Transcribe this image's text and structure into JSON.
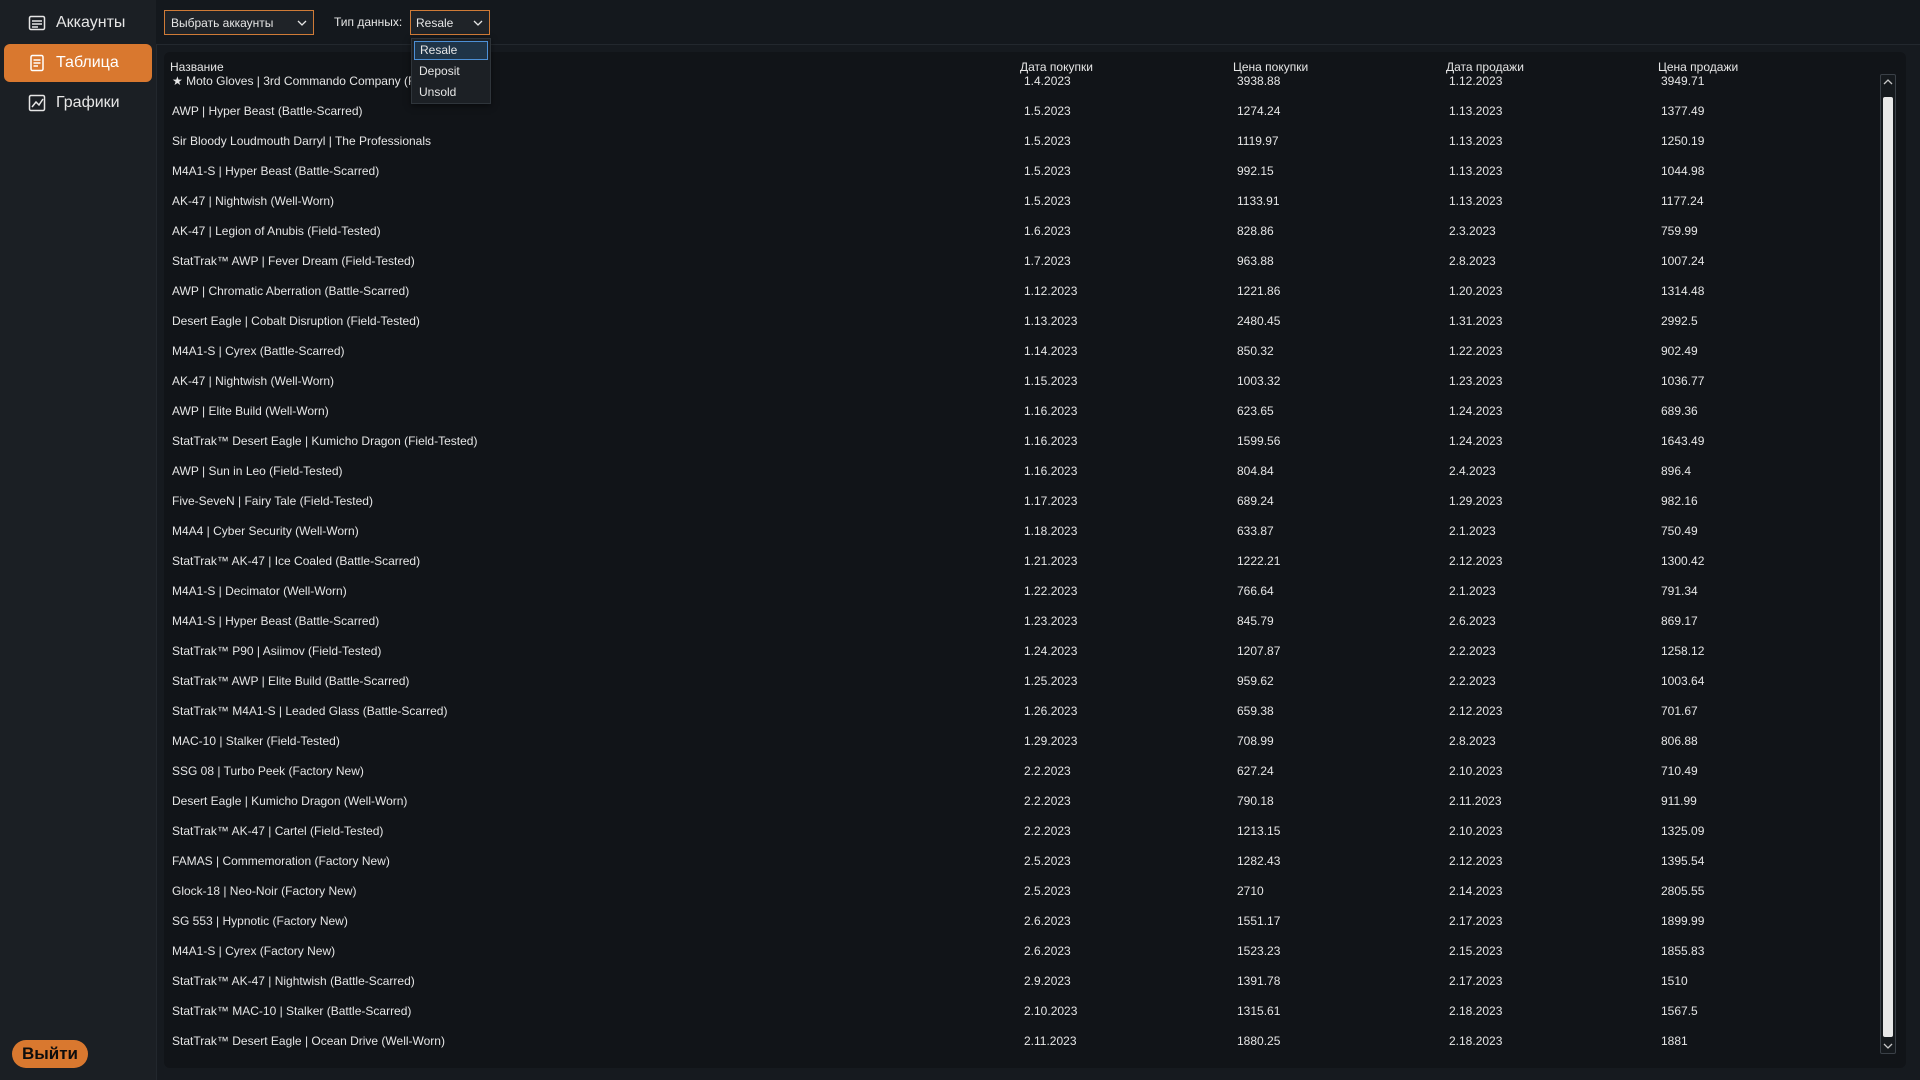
{
  "sidebar": {
    "items": [
      {
        "label": "Аккаунты",
        "icon": "accounts-icon"
      },
      {
        "label": "Таблица",
        "icon": "table-icon",
        "active": true
      },
      {
        "label": "Графики",
        "icon": "chart-icon"
      }
    ],
    "logout_label": "Выйти"
  },
  "toolbar": {
    "account_select": "Выбрать аккаунты",
    "type_label": "Тип данных:",
    "type_value": "Resale",
    "type_options": [
      "Resale",
      "Deposit",
      "Unsold"
    ]
  },
  "table": {
    "headers": [
      "Название",
      "Дата покупки",
      "Цена покупки",
      "Дата продажи",
      "Цена продажи"
    ],
    "rows": [
      [
        "★ Moto Gloves | 3rd Commando Company (F",
        "1.4.2023",
        "3938.88",
        "1.12.2023",
        "3949.71"
      ],
      [
        "AWP | Hyper Beast (Battle-Scarred)",
        "1.5.2023",
        "1274.24",
        "1.13.2023",
        "1377.49"
      ],
      [
        "Sir Bloody Loudmouth Darryl | The Professionals",
        "1.5.2023",
        "1119.97",
        "1.13.2023",
        "1250.19"
      ],
      [
        "M4A1-S | Hyper Beast (Battle-Scarred)",
        "1.5.2023",
        "992.15",
        "1.13.2023",
        "1044.98"
      ],
      [
        "AK-47 | Nightwish (Well-Worn)",
        "1.5.2023",
        "1133.91",
        "1.13.2023",
        "1177.24"
      ],
      [
        "AK-47 | Legion of Anubis (Field-Tested)",
        "1.6.2023",
        "828.86",
        "2.3.2023",
        "759.99"
      ],
      [
        "StatTrak™ AWP | Fever Dream (Field-Tested)",
        "1.7.2023",
        "963.88",
        "2.8.2023",
        "1007.24"
      ],
      [
        "AWP | Chromatic Aberration (Battle-Scarred)",
        "1.12.2023",
        "1221.86",
        "1.20.2023",
        "1314.48"
      ],
      [
        "Desert Eagle | Cobalt Disruption (Field-Tested)",
        "1.13.2023",
        "2480.45",
        "1.31.2023",
        "2992.5"
      ],
      [
        "M4A1-S | Cyrex (Battle-Scarred)",
        "1.14.2023",
        "850.32",
        "1.22.2023",
        "902.49"
      ],
      [
        "AK-47 | Nightwish (Well-Worn)",
        "1.15.2023",
        "1003.32",
        "1.23.2023",
        "1036.77"
      ],
      [
        "AWP | Elite Build (Well-Worn)",
        "1.16.2023",
        "623.65",
        "1.24.2023",
        "689.36"
      ],
      [
        "StatTrak™ Desert Eagle | Kumicho Dragon (Field-Tested)",
        "1.16.2023",
        "1599.56",
        "1.24.2023",
        "1643.49"
      ],
      [
        "AWP | Sun in Leo (Field-Tested)",
        "1.16.2023",
        "804.84",
        "2.4.2023",
        "896.4"
      ],
      [
        "Five-SeveN | Fairy Tale (Field-Tested)",
        "1.17.2023",
        "689.24",
        "1.29.2023",
        "982.16"
      ],
      [
        "M4A4 | Cyber Security (Well-Worn)",
        "1.18.2023",
        "633.87",
        "2.1.2023",
        "750.49"
      ],
      [
        "StatTrak™ AK-47 | Ice Coaled (Battle-Scarred)",
        "1.21.2023",
        "1222.21",
        "2.12.2023",
        "1300.42"
      ],
      [
        "M4A1-S | Decimator (Well-Worn)",
        "1.22.2023",
        "766.64",
        "2.1.2023",
        "791.34"
      ],
      [
        "M4A1-S | Hyper Beast (Battle-Scarred)",
        "1.23.2023",
        "845.79",
        "2.6.2023",
        "869.17"
      ],
      [
        "StatTrak™ P90 | Asiimov (Field-Tested)",
        "1.24.2023",
        "1207.87",
        "2.2.2023",
        "1258.12"
      ],
      [
        "StatTrak™ AWP | Elite Build (Battle-Scarred)",
        "1.25.2023",
        "959.62",
        "2.2.2023",
        "1003.64"
      ],
      [
        "StatTrak™ M4A1-S | Leaded Glass (Battle-Scarred)",
        "1.26.2023",
        "659.38",
        "2.12.2023",
        "701.67"
      ],
      [
        "MAC-10 | Stalker (Field-Tested)",
        "1.29.2023",
        "708.99",
        "2.8.2023",
        "806.88"
      ],
      [
        "SSG 08 | Turbo Peek (Factory New)",
        "2.2.2023",
        "627.24",
        "2.10.2023",
        "710.49"
      ],
      [
        "Desert Eagle | Kumicho Dragon (Well-Worn)",
        "2.2.2023",
        "790.18",
        "2.11.2023",
        "911.99"
      ],
      [
        "StatTrak™ AK-47 | Cartel (Field-Tested)",
        "2.2.2023",
        "1213.15",
        "2.10.2023",
        "1325.09"
      ],
      [
        "FAMAS | Commemoration (Factory New)",
        "2.5.2023",
        "1282.43",
        "2.12.2023",
        "1395.54"
      ],
      [
        "Glock-18 | Neo-Noir (Factory New)",
        "2.5.2023",
        "2710",
        "2.14.2023",
        "2805.55"
      ],
      [
        "SG 553 | Hypnotic (Factory New)",
        "2.6.2023",
        "1551.17",
        "2.17.2023",
        "1899.99"
      ],
      [
        "M4A1-S | Cyrex (Factory New)",
        "2.6.2023",
        "1523.23",
        "2.15.2023",
        "1855.83"
      ],
      [
        "StatTrak™ AK-47 | Nightwish (Battle-Scarred)",
        "2.9.2023",
        "1391.78",
        "2.17.2023",
        "1510"
      ],
      [
        "StatTrak™ MAC-10 | Stalker (Battle-Scarred)",
        "2.10.2023",
        "1315.61",
        "2.18.2023",
        "1567.5"
      ],
      [
        "StatTrak™ Desert Eagle | Ocean Drive (Well-Worn)",
        "2.11.2023",
        "1880.25",
        "2.18.2023",
        "1881"
      ]
    ]
  },
  "colors": {
    "accent": "#d9782f",
    "background": "#161a1f",
    "selection": "#4d90d6"
  }
}
